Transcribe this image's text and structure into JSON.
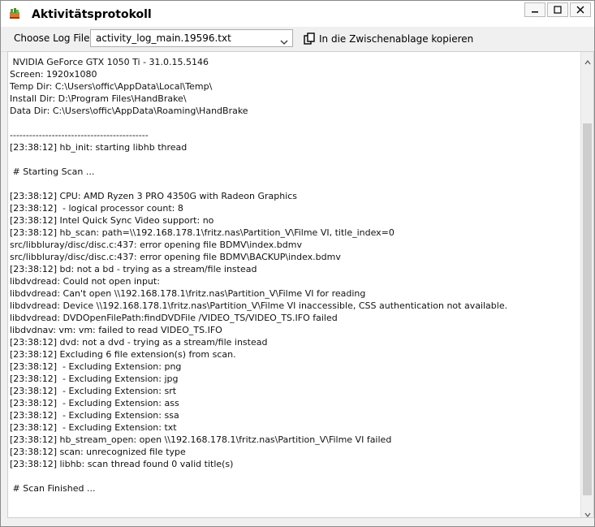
{
  "window": {
    "title": "Aktivitätsprotokoll"
  },
  "toolbar": {
    "label": "Choose Log File:",
    "selected_log": "activity_log_main.19596.txt",
    "copy_label": "In die Zwischenablage kopieren"
  },
  "log_lines": [
    " NVIDIA GeForce GTX 1050 Ti - 31.0.15.5146",
    "Screen: 1920x1080",
    "Temp Dir: C:\\Users\\offic\\AppData\\Local\\Temp\\",
    "Install Dir: D:\\Program Files\\HandBrake\\",
    "Data Dir: C:\\Users\\offic\\AppData\\Roaming\\HandBrake",
    "",
    "-------------------------------------------",
    "[23:38:12] hb_init: starting libhb thread",
    "",
    " # Starting Scan ...",
    "",
    "[23:38:12] CPU: AMD Ryzen 3 PRO 4350G with Radeon Graphics",
    "[23:38:12]  - logical processor count: 8",
    "[23:38:12] Intel Quick Sync Video support: no",
    "[23:38:12] hb_scan: path=\\\\192.168.178.1\\fritz.nas\\Partition_V\\Filme VI, title_index=0",
    "src/libbluray/disc/disc.c:437: error opening file BDMV\\index.bdmv",
    "src/libbluray/disc/disc.c:437: error opening file BDMV\\BACKUP\\index.bdmv",
    "[23:38:12] bd: not a bd - trying as a stream/file instead",
    "libdvdread: Could not open input:",
    "libdvdread: Can't open \\\\192.168.178.1\\fritz.nas\\Partition_V\\Filme VI for reading",
    "libdvdread: Device \\\\192.168.178.1\\fritz.nas\\Partition_V\\Filme VI inaccessible, CSS authentication not available.",
    "libdvdread: DVDOpenFilePath:findDVDFile /VIDEO_TS/VIDEO_TS.IFO failed",
    "libdvdnav: vm: vm: failed to read VIDEO_TS.IFO",
    "[23:38:12] dvd: not a dvd - trying as a stream/file instead",
    "[23:38:12] Excluding 6 file extension(s) from scan.",
    "[23:38:12]  - Excluding Extension: png",
    "[23:38:12]  - Excluding Extension: jpg",
    "[23:38:12]  - Excluding Extension: srt",
    "[23:38:12]  - Excluding Extension: ass",
    "[23:38:12]  - Excluding Extension: ssa",
    "[23:38:12]  - Excluding Extension: txt",
    "[23:38:12] hb_stream_open: open \\\\192.168.178.1\\fritz.nas\\Partition_V\\Filme VI failed",
    "[23:38:12] scan: unrecognized file type",
    "[23:38:12] libhb: scan thread found 0 valid title(s)",
    "",
    " # Scan Finished ..."
  ]
}
